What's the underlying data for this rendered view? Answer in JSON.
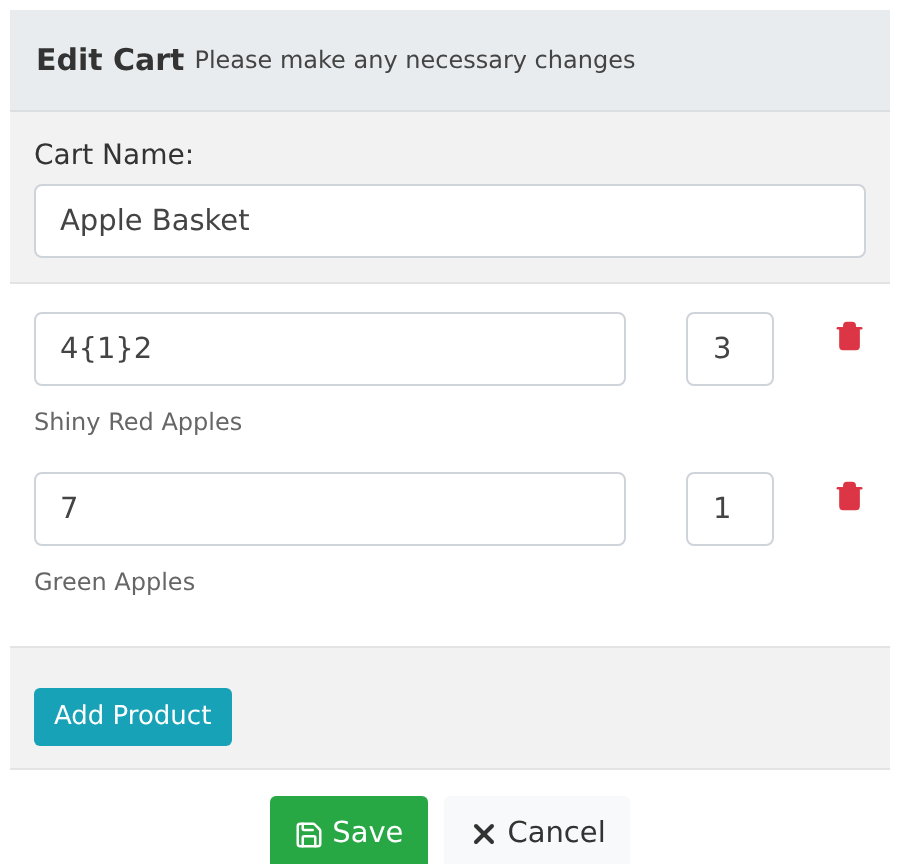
{
  "header": {
    "title": "Edit Cart",
    "subtitle": "Please make any necessary changes"
  },
  "cart_name": {
    "label": "Cart Name:",
    "value": "Apple Basket"
  },
  "products": [
    {
      "code": "4{1}2",
      "quantity": "3",
      "name": "Shiny Red Apples"
    },
    {
      "code": "7",
      "quantity": "1",
      "name": "Green Apples"
    }
  ],
  "add_button": "Add Product",
  "buttons": [
    {
      "kind": "save",
      "label": "Save"
    },
    {
      "kind": "cancel",
      "label": "Cancel"
    }
  ]
}
